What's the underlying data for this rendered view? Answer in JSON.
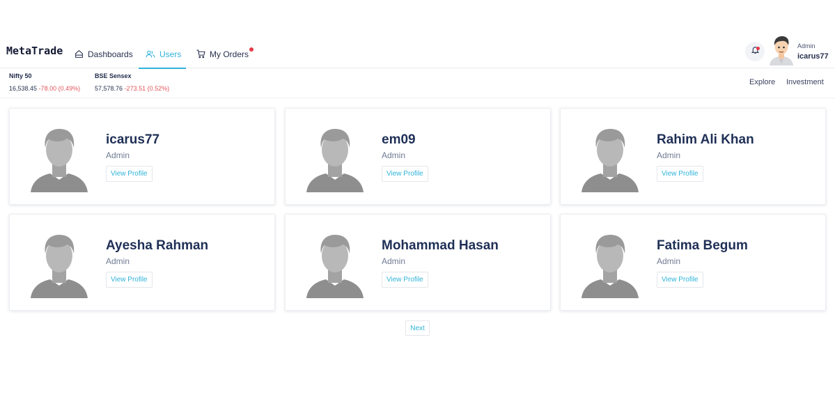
{
  "brand": "MetaTrade",
  "nav": {
    "dashboards": "Dashboards",
    "users": "Users",
    "orders": "My Orders"
  },
  "user": {
    "role": "Admin",
    "name": "icarus77"
  },
  "tickers": [
    {
      "name": "Nifty 50",
      "value": "16,538.45",
      "change": "-78.00 (0.49%)"
    },
    {
      "name": "BSE Sensex",
      "value": "57,578.76",
      "change": "-273.51 (0.52%)"
    }
  ],
  "links": {
    "explore": "Explore",
    "investment": "Investment"
  },
  "users": [
    {
      "name": "icarus77",
      "role": "Admin",
      "button": "View Profile"
    },
    {
      "name": "em09",
      "role": "Admin",
      "button": "View Profile"
    },
    {
      "name": "Rahim Ali Khan",
      "role": "Admin",
      "button": "View Profile"
    },
    {
      "name": "Ayesha Rahman",
      "role": "Admin",
      "button": "View Profile"
    },
    {
      "name": "Mohammad Hasan",
      "role": "Admin",
      "button": "View Profile"
    },
    {
      "name": "Fatima Begum",
      "role": "Admin",
      "button": "View Profile"
    }
  ],
  "pagination": {
    "next": "Next"
  },
  "colors": {
    "accent": "#2fb3d9",
    "negative": "#e2555b",
    "notification": "#e63946"
  }
}
